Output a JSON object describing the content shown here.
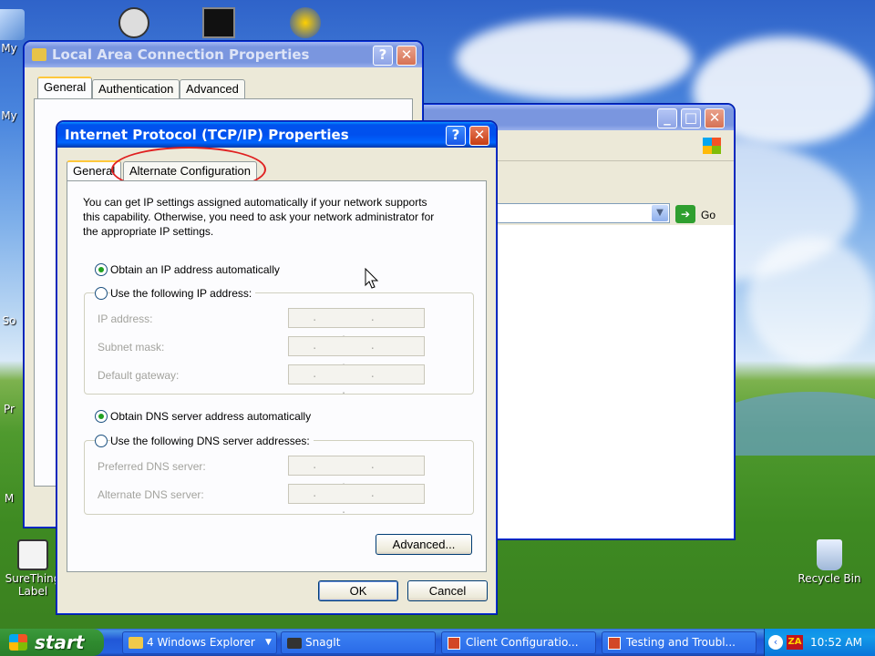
{
  "desktop": {
    "icons": [
      {
        "label": "My",
        "icon": "my-computer-icon"
      },
      {
        "label": "My",
        "icon": "my-documents-icon"
      },
      {
        "label": "So",
        "icon": "software-icon"
      },
      {
        "label": "Pr",
        "icon": "printer-icon"
      },
      {
        "label": "M",
        "icon": "mail-icon"
      },
      {
        "label": "SureThing Label",
        "icon": "surething-icon"
      },
      {
        "label": "Recycle Bin",
        "icon": "recycle-bin-icon"
      }
    ]
  },
  "lac_window": {
    "title": "Local Area Connection Properties",
    "tabs": [
      "General",
      "Authentication",
      "Advanced"
    ]
  },
  "explorer_window": {
    "go_label": "Go"
  },
  "tcpip_dialog": {
    "title": "Internet Protocol (TCP/IP) Properties",
    "tabs": [
      "General",
      "Alternate Configuration"
    ],
    "intro": [
      "You can get IP settings assigned automatically if your network supports",
      "this capability. Otherwise, you need to ask your network administrator for",
      "the appropriate IP settings."
    ],
    "radio_obtain_ip": "Obtain an IP address automatically",
    "radio_use_ip": "Use the following IP address:",
    "ip_address": "IP address:",
    "subnet_mask": "Subnet mask:",
    "default_gateway": "Default gateway:",
    "radio_obtain_dns": "Obtain DNS server address automatically",
    "radio_use_dns": "Use the following DNS server addresses:",
    "preferred_dns": "Preferred DNS server:",
    "alternate_dns": "Alternate DNS server:",
    "ip_placeholder": ". . .",
    "advanced_button": "Advanced...",
    "ok_button": "OK",
    "cancel_button": "Cancel",
    "highlight_color": "#e02020"
  },
  "taskbar": {
    "start": "start",
    "items": [
      "4 Windows Explorer",
      "SnagIt",
      "Client Configuratio...",
      "Testing and Troubl..."
    ],
    "clock": "10:52 AM"
  }
}
